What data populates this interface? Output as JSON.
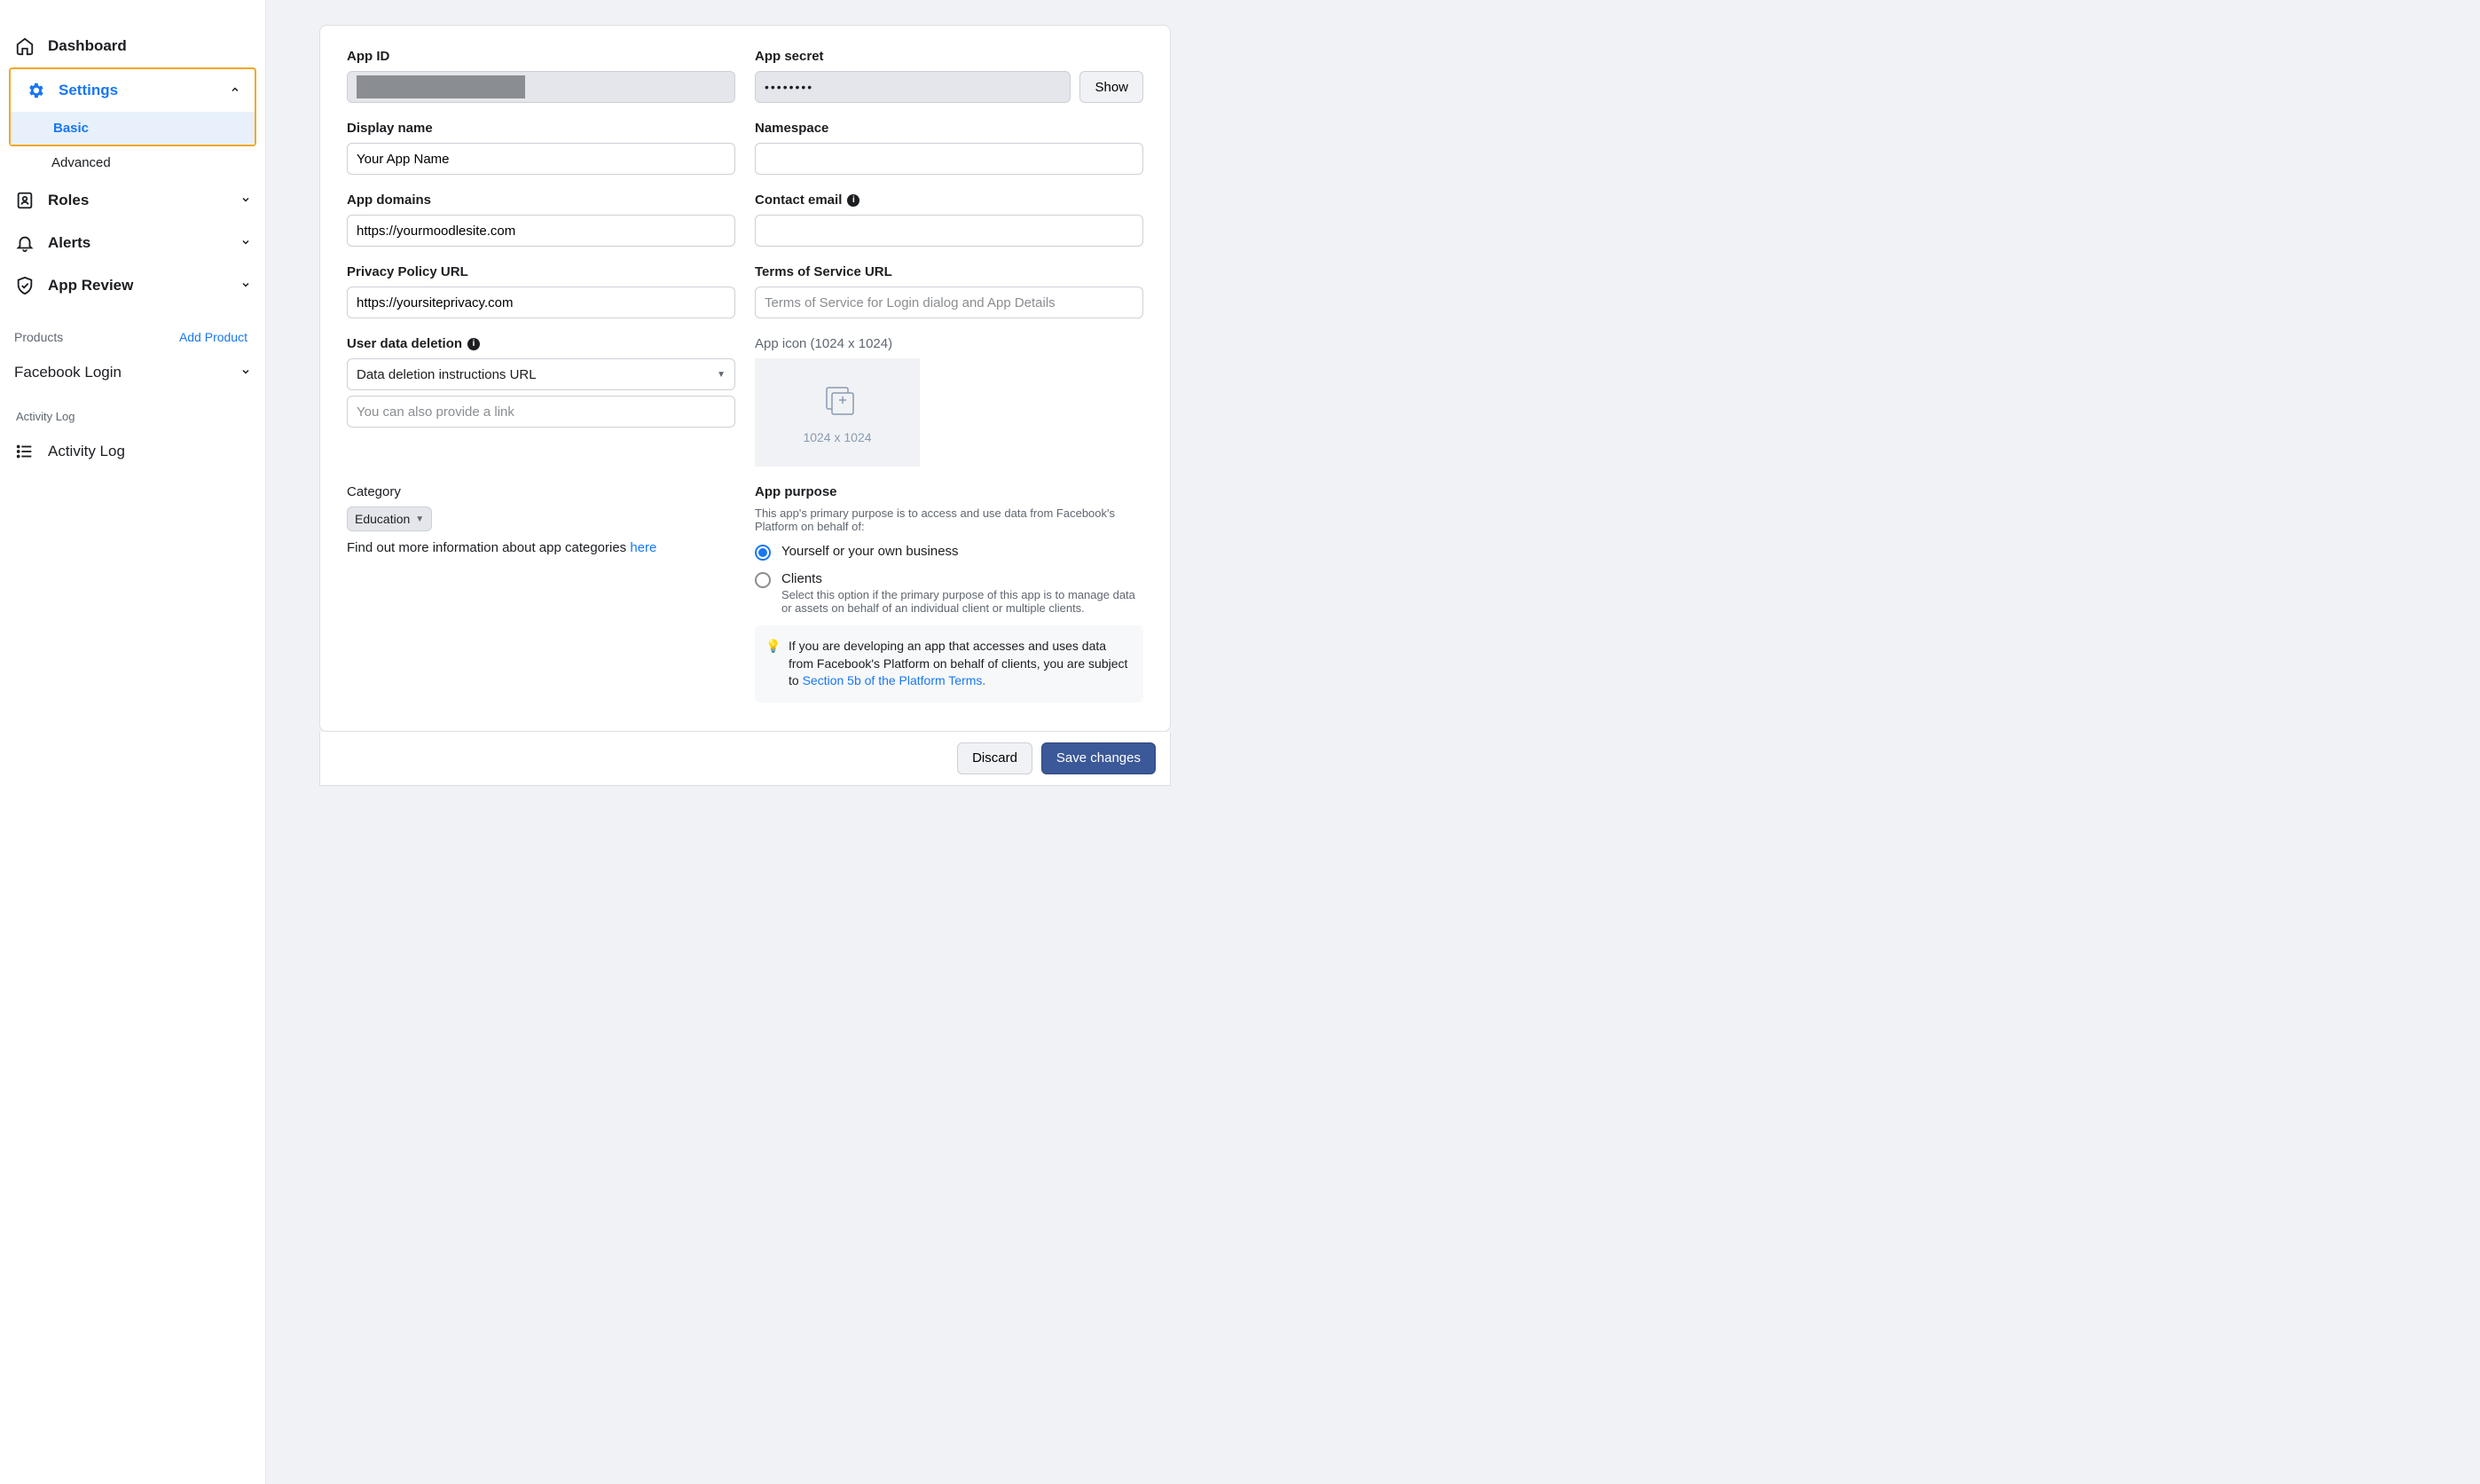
{
  "sidebar": {
    "dashboard": "Dashboard",
    "settings": "Settings",
    "settings_basic": "Basic",
    "settings_advanced": "Advanced",
    "roles": "Roles",
    "alerts": "Alerts",
    "app_review": "App Review",
    "products_label": "Products",
    "add_product": "Add Product",
    "facebook_login": "Facebook Login",
    "activity_log_header": "Activity Log",
    "activity_log": "Activity Log"
  },
  "fields": {
    "app_id": {
      "label": "App ID"
    },
    "app_secret": {
      "label": "App secret",
      "value": "••••••••",
      "show_btn": "Show"
    },
    "display_name": {
      "label": "Display name",
      "value": "Your App Name"
    },
    "namespace": {
      "label": "Namespace",
      "value": ""
    },
    "app_domains": {
      "label": "App domains",
      "value": "https://yourmoodlesite.com"
    },
    "contact_email": {
      "label": "Contact email",
      "value": ""
    },
    "privacy_url": {
      "label": "Privacy Policy URL",
      "value": "https://yoursiteprivacy.com"
    },
    "tos_url": {
      "label": "Terms of Service URL",
      "placeholder": "Terms of Service for Login dialog and App Details"
    },
    "user_data_deletion": {
      "label": "User data deletion",
      "select_value": "Data deletion instructions URL",
      "link_placeholder": "You can also provide a link"
    },
    "app_icon": {
      "label": "App icon (1024 x 1024)",
      "hint": "1024 x 1024"
    },
    "category": {
      "label": "Category",
      "value": "Education",
      "help_text": "Find out more information about app categories ",
      "help_link": "here"
    },
    "app_purpose": {
      "label": "App purpose",
      "desc": "This app's primary purpose is to access and use data from Facebook's Platform on behalf of:",
      "opt1": "Yourself or your own business",
      "opt2": "Clients",
      "opt2_sub": "Select this option if the primary purpose of this app is to manage data or assets on behalf of an individual client or multiple clients.",
      "info": "If you are developing an app that accesses and uses data from Facebook's Platform on behalf of clients, you are subject to ",
      "info_link": "Section 5b of the Platform Terms."
    }
  },
  "footer": {
    "discard": "Discard",
    "save": "Save changes"
  }
}
